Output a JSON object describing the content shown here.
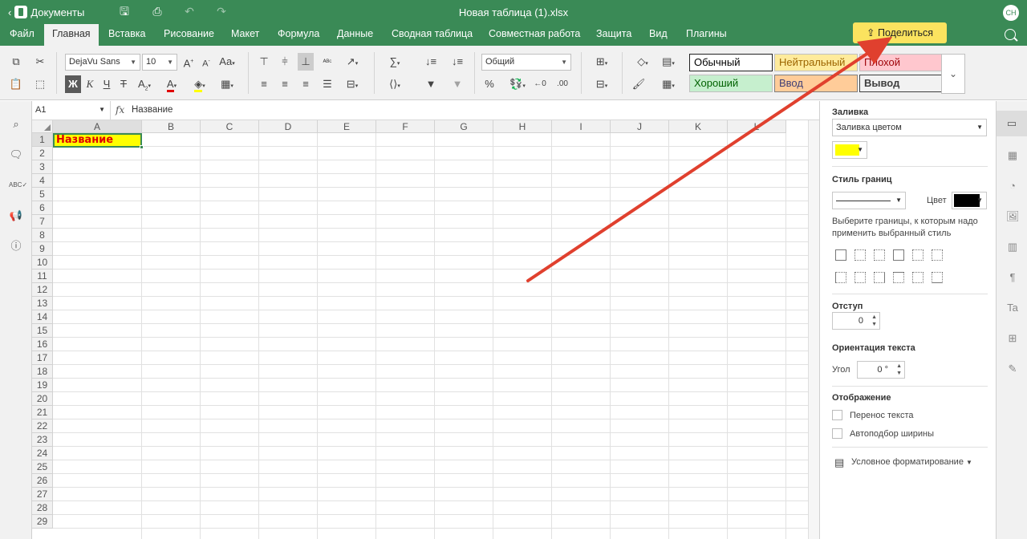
{
  "app": {
    "back_label": "Документы",
    "doc_title": "Новая таблица (1).xlsx",
    "avatar": "СН"
  },
  "menu": {
    "tabs": [
      "Файл",
      "Главная",
      "Вставка",
      "Рисование",
      "Макет",
      "Формула",
      "Данные",
      "Сводная таблица",
      "Совместная работа",
      "Защита",
      "Вид",
      "Плагины"
    ],
    "active": "Главная",
    "share_label": "Поделиться"
  },
  "toolbar": {
    "font_name": "DejaVu Sans",
    "font_size": "10",
    "number_format": "Общий",
    "bold": "Ж",
    "italic": "К",
    "underline": "Ч",
    "strike": "Т",
    "percent": "%",
    "styles": [
      {
        "label": "Обычный",
        "bg": "#ffffff",
        "fg": "#000000",
        "border": "#222222"
      },
      {
        "label": "Нейтральный",
        "bg": "#ffeb9c",
        "fg": "#9c6500",
        "border": "#c0c0c0"
      },
      {
        "label": "Плохой",
        "bg": "#ffc7ce",
        "fg": "#9c0006",
        "border": "#c0c0c0"
      },
      {
        "label": "Хороший",
        "bg": "#c6efce",
        "fg": "#006100",
        "border": "#c0c0c0"
      },
      {
        "label": "Ввод",
        "bg": "#ffcc99",
        "fg": "#3f3f76",
        "border": "#7f7f7f"
      },
      {
        "label": "Вывод",
        "bg": "#f2f2f2",
        "fg": "#3f3f3f",
        "border": "#3f3f3f"
      }
    ]
  },
  "formula_bar": {
    "cell_name": "A1",
    "fx": "fx",
    "value": "Название"
  },
  "sheet": {
    "columns": [
      "A",
      "B",
      "C",
      "D",
      "E",
      "F",
      "G",
      "H",
      "I",
      "J",
      "K",
      "L"
    ],
    "rows": [
      "1",
      "2",
      "3",
      "4",
      "5",
      "6",
      "7",
      "8",
      "9",
      "10",
      "11",
      "12",
      "13",
      "14",
      "15",
      "16",
      "17",
      "18",
      "19",
      "20",
      "21",
      "22",
      "23",
      "24",
      "25",
      "26",
      "27",
      "28",
      "29"
    ],
    "a1_value": "Название"
  },
  "right_panel": {
    "fill_title": "Заливка",
    "fill_type": "Заливка цветом",
    "fill_color": "#ffff00",
    "border_style_title": "Стиль границ",
    "color_label": "Цвет",
    "border_color": "#000000",
    "border_hint": "Выберите границы, к которым надо применить выбранный стиль",
    "indent_title": "Отступ",
    "indent_value": "0",
    "orientation_title": "Ориентация текста",
    "angle_label": "Угол",
    "angle_value": "0 °",
    "display_title": "Отображение",
    "wrap_label": "Перенос текста",
    "autofit_label": "Автоподбор ширины",
    "cond_format_label": "Условное форматирование"
  },
  "colors": {
    "header_green": "#3a8a56",
    "share_button": "#fbe35f",
    "arrow": "#e0402e"
  }
}
